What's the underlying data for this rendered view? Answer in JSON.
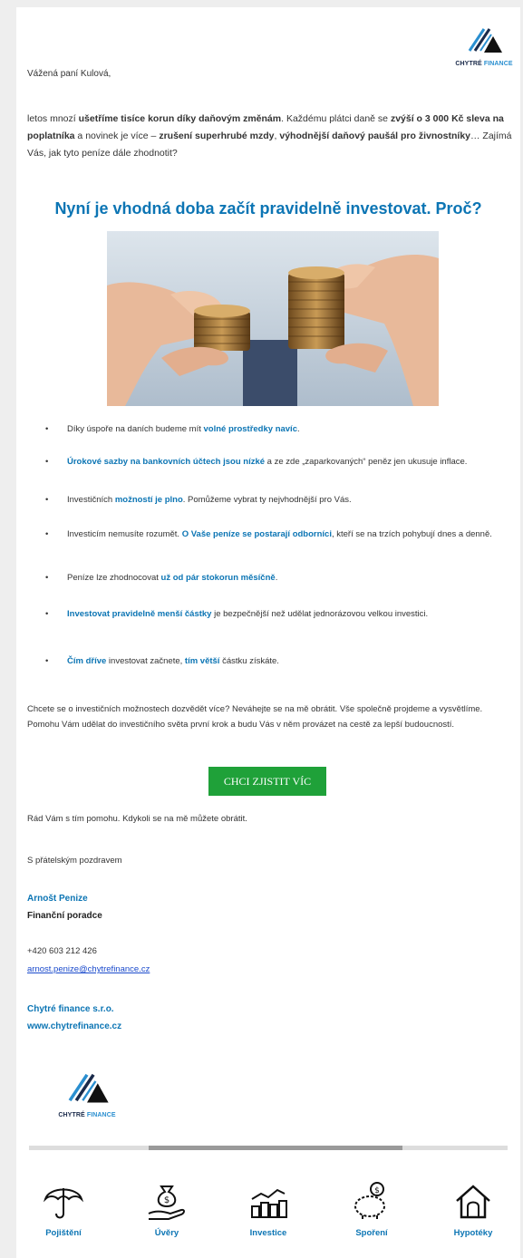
{
  "brand": {
    "name_part1": "CHYTRÉ",
    "name_part2": "FINANCE"
  },
  "email": {
    "greeting": "Vážená paní Kulová,",
    "intro": [
      {
        "t": "letos mnozí ",
        "b": false
      },
      {
        "t": "ušetříme tisíce korun díky daňovým změnám",
        "b": true
      },
      {
        "t": ". Každému plátci daně se ",
        "b": false
      },
      {
        "t": "zvýší o 3 000 Kč sleva na poplatníka",
        "b": true
      },
      {
        "t": " a novinek je více – ",
        "b": false
      },
      {
        "t": "zrušení superhrubé mzdy",
        "b": true
      },
      {
        "t": ", ",
        "b": false
      },
      {
        "t": "výhodnější daňový paušál pro živnostníky",
        "b": true
      },
      {
        "t": "… Zajímá Vás, jak tyto peníze dále zhodnotit?",
        "b": false
      }
    ],
    "headline": "Nyní je vhodná doba začít pravidelně investovat. Proč?",
    "bullets": [
      [
        {
          "t": "Díky úspoře na daních budeme mít ",
          "s": ""
        },
        {
          "t": "volné prostředky navíc",
          "s": "em"
        },
        {
          "t": ".",
          "s": ""
        }
      ],
      [
        {
          "t": "Úrokové sazby na bankovních účtech jsou nízké",
          "s": "em"
        },
        {
          "t": " a ze zde „zaparkovaných“ peněz jen ukusuje inflace.",
          "s": ""
        }
      ],
      [
        {
          "t": "Investičních ",
          "s": ""
        },
        {
          "t": "možností je plno",
          "s": "em"
        },
        {
          "t": ". Pomůžeme vybrat ty nejvhodnější pro Vás.",
          "s": ""
        }
      ],
      [
        {
          "t": "Investicím nemusíte rozumět. ",
          "s": ""
        },
        {
          "t": "O Vaše peníze se postarají odborníci",
          "s": "em"
        },
        {
          "t": ", kteří se na trzích pohybují dnes a denně.",
          "s": ""
        }
      ],
      [
        {
          "t": "Peníze lze zhodnocovat ",
          "s": ""
        },
        {
          "t": "už od pár stokorun měsíčně",
          "s": "em"
        },
        {
          "t": ".",
          "s": ""
        }
      ],
      [
        {
          "t": "Investovat pravidelně menší částky",
          "s": "em"
        },
        {
          "t": " je bezpečnější než udělat jednorázovou velkou investici.",
          "s": ""
        }
      ],
      [
        {
          "t": "Čím dříve",
          "s": "em"
        },
        {
          "t": " investovat začnete, ",
          "s": ""
        },
        {
          "t": "tím větší",
          "s": "em"
        },
        {
          "t": " částku získáte.",
          "s": ""
        }
      ]
    ],
    "paragraph2": "Chcete se o investičních možnostech dozvědět více? Neváhejte se na mě obrátit. Vše společně projdeme a vysvětlíme. Pomohu Vám udělat do investičního světa první krok a budu Vás v něm provázet na cestě za lepší budoucností.",
    "cta_label": "CHCI ZJISTIT VÍC",
    "help_line": "Rád Vám s tím pomohu. Kdykoli se na mě můžete obrátit.",
    "regards": "S přátelským pozdravem",
    "signature": {
      "name": "Arnošt Penize",
      "role": "Finanční poradce",
      "phone": "+420 603 212 426",
      "email": "arnost.penize@chytrefinance.cz",
      "company": "Chytré finance s.r.o.",
      "website": "www.chytrefinance.cz"
    }
  },
  "nav": {
    "items": [
      {
        "label": "Pojištění",
        "icon": "umbrella-icon"
      },
      {
        "label": "Úvěry",
        "icon": "money-bag-hand-icon"
      },
      {
        "label": "Investice",
        "icon": "coins-chart-icon"
      },
      {
        "label": "Spoření",
        "icon": "piggy-bank-icon"
      },
      {
        "label": "Hypotéky",
        "icon": "house-icon"
      }
    ]
  },
  "colors": {
    "accent": "#0c75b4",
    "cta": "#1fa139",
    "link": "#1a4acc"
  }
}
